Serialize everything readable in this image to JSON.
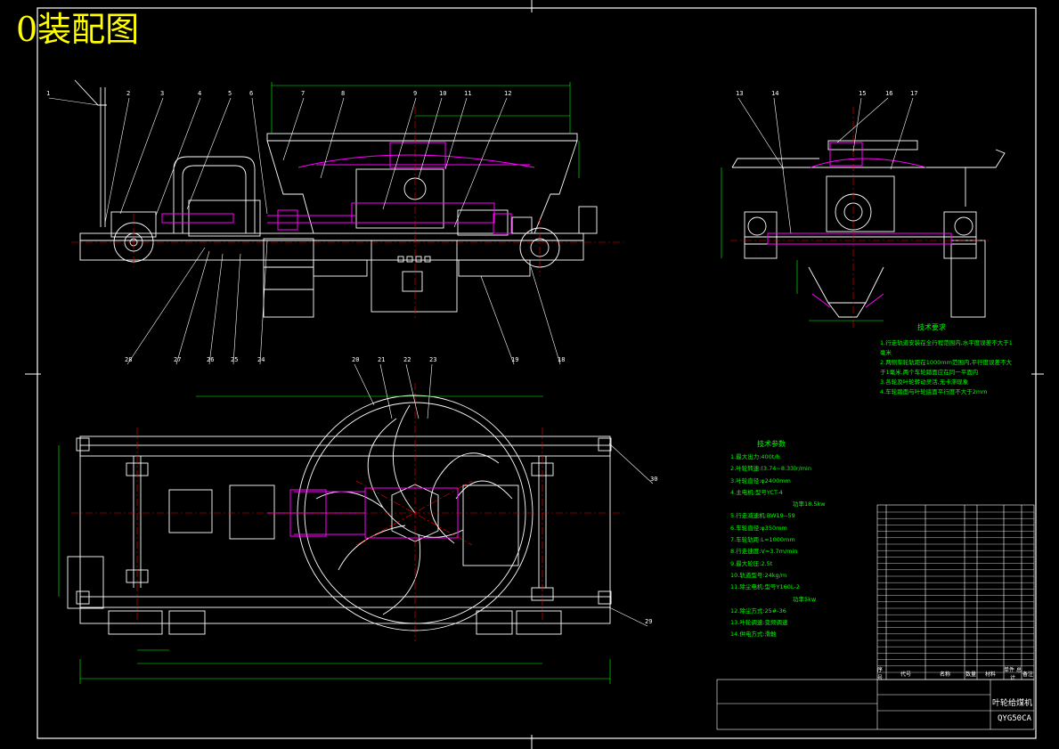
{
  "title": "0装配图",
  "colors": {
    "background": "#000000",
    "outline": "#ffffff",
    "title": "#ffff00",
    "dimension": "#00ff00",
    "highlight": "#ff00ff",
    "centerline": "#ff0000",
    "notes": "#00ff00"
  },
  "part_numbers_top": [
    "1",
    "2",
    "3",
    "4",
    "5",
    "6",
    "7",
    "8",
    "9",
    "10",
    "11",
    "12"
  ],
  "part_numbers_side": [
    "13",
    "14",
    "15",
    "16",
    "17"
  ],
  "part_numbers_bottom": [
    "28",
    "27",
    "26",
    "25",
    "24",
    "20",
    "21",
    "22",
    "23",
    "19",
    "18"
  ],
  "part_numbers_plan": [
    "30",
    "29"
  ],
  "tech_requirements": {
    "heading": "技术要求",
    "items": [
      "1.行走轨道安装在全行程范围内,水平度误差不大于1毫米",
      "2.两侧车轮轨距在1000mm范围内,平行度误差不大于1毫米,两个车轮踏面应在同一平面内",
      "3.各轮及叶轮转动灵活,无卡滞现象",
      "4.车轮踏面与叶轮底面平行度不大于2mm"
    ]
  },
  "tech_params": {
    "heading": "技术参数",
    "items": [
      "1.最大出力:400t/h",
      "2.叶轮转速:(3.74~8.33)r/min",
      "3.叶轮直径:φ2400mm",
      "4.主电机:型号YCT-4",
      "功率18.5kw",
      "5.行走减速机:BW19--59",
      "6.车轮直径:φ350mm",
      "7.车轮轨距:L=1000mm",
      "8.行走速度:V=3.7m/min",
      "9.最大轮压:2.5t",
      "10.轨道型号:24kg/m",
      "11.除尘电机:型号Y160L-2",
      "功率5kw",
      "12.除尘方式:25#-36",
      "13.叶轮调速:变频调速",
      "14.供电方式:滑触"
    ]
  },
  "title_block": {
    "drawing_name": "叶轮给煤机",
    "drawing_code": "QYG50CA",
    "header_cells": [
      "序号",
      "代号",
      "名称",
      "数量",
      "材料",
      "单件 总计",
      "备注"
    ]
  }
}
